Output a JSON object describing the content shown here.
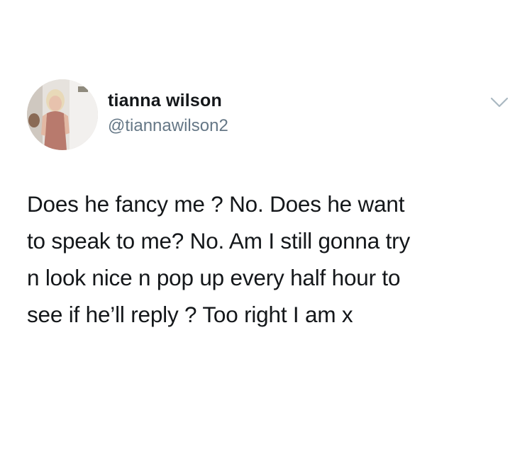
{
  "user": {
    "display_name": "tianna wilson",
    "handle": "@tiannawilson2"
  },
  "tweet": {
    "lines": [
      "Does he fancy me ? No. Does he want",
      "to speak to me? No. Am I still gonna try",
      "n look nice n pop up every half hour to",
      "see if he’ll reply ? Too right I am x"
    ]
  },
  "icons": {
    "avatar": "profile-photo",
    "menu": "chevron-down-icon"
  },
  "colors": {
    "text": "#14171a",
    "handle": "#657786",
    "chevron": "#aab8c2",
    "background": "#ffffff"
  }
}
